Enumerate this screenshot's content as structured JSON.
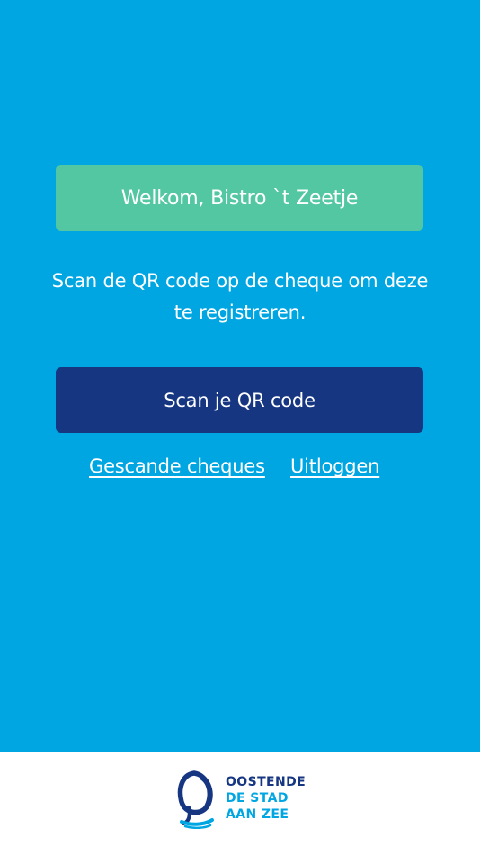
{
  "welcome": {
    "text": "Welkom, Bistro `t Zeetje"
  },
  "instruction": {
    "text": "Scan de QR code op de cheque om deze te registreren."
  },
  "scan_button": {
    "label": "Scan je QR code"
  },
  "links": {
    "scanned_cheques": "Gescande cheques",
    "logout": "Uitloggen"
  },
  "footer": {
    "logo": {
      "line1": "OOSTENDE",
      "line2": "DE STAD",
      "line3": "AAN ZEE",
      "icon": "oostende-logo-icon"
    }
  },
  "colors": {
    "background": "#00a6e2",
    "welcome_banner": "#53c7a1",
    "primary_button": "#163682",
    "footer": "#ffffff"
  }
}
